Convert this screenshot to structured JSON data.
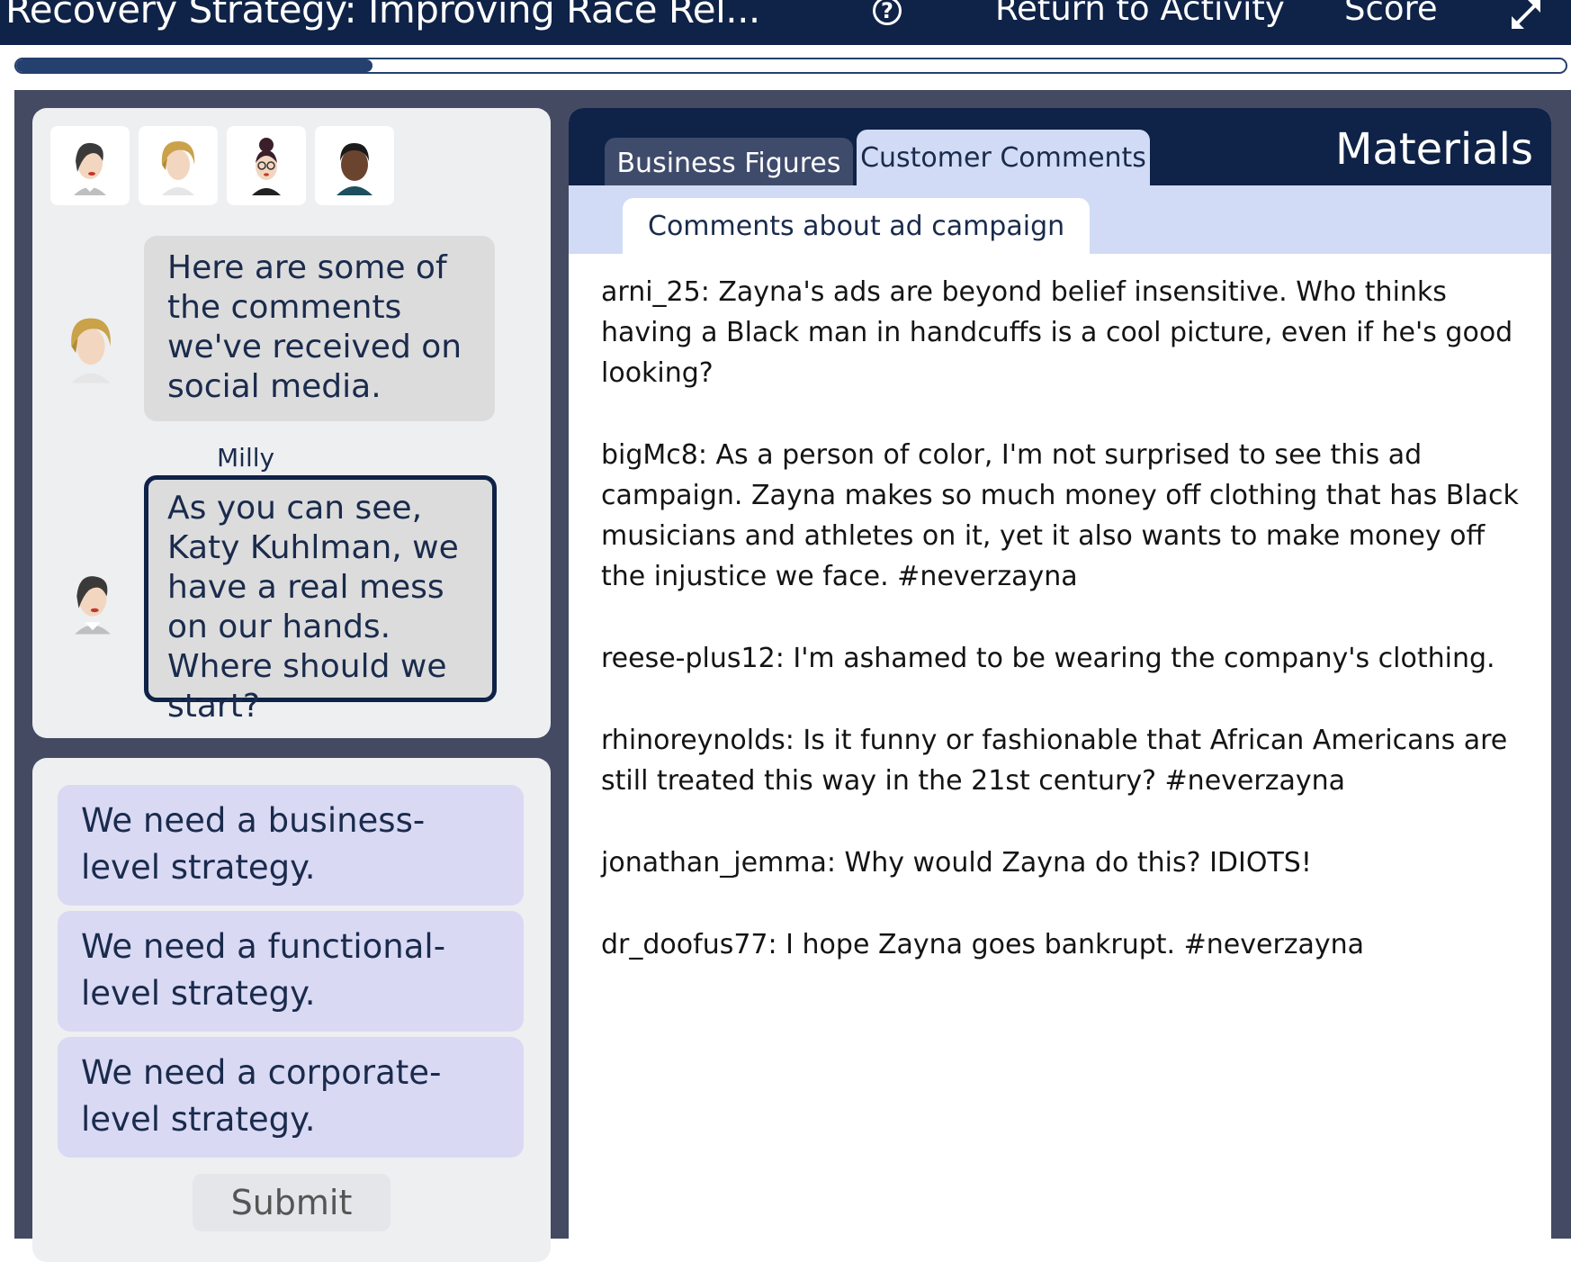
{
  "header": {
    "title": "Recovery Strategy: Improving Race Rel...",
    "help_glyph": "?",
    "return_label": "Return to Activity",
    "score_label": "Score"
  },
  "progress": {
    "fraction": 0.23
  },
  "chat": {
    "avatars": [
      {
        "name": "dark-hair-woman-avatar"
      },
      {
        "name": "blonde-woman-avatar"
      },
      {
        "name": "glasses-woman-avatar"
      },
      {
        "name": "dark-skin-man-avatar"
      }
    ],
    "messages": [
      {
        "text": "Here are some of the comments we've received on social media.",
        "speaker": "Milly"
      },
      {
        "text": "As you can see, Katy Kuhlman, we have a real mess on our hands. Where should we start?"
      }
    ]
  },
  "options": [
    {
      "label": "We need a business-level strategy."
    },
    {
      "label": "We need a functional-level strategy."
    },
    {
      "label": "We need a corporate-level strategy."
    }
  ],
  "submit_label": "Submit",
  "materials": {
    "title": "Materials",
    "tabs": [
      {
        "label": "Business Figures"
      },
      {
        "label": "Customer Comments"
      }
    ],
    "subtab": "Comments about ad campaign",
    "comments": [
      "arni_25: Zayna's ads are beyond belief insensitive. Who thinks having a Black man in handcuffs is a cool picture, even if he's good looking?",
      "bigMc8: As a person of color, I'm not surprised to see this ad campaign. Zayna makes so much money off clothing that has Black musicians and athletes on it, yet it also wants to make money off the injustice we face. #neverzayna",
      "reese-plus12: I'm ashamed to be wearing the company's clothing.",
      "rhinoreynolds: Is it funny or fashionable that African Americans are still treated this way in the 21st century? #neverzayna",
      "jonathan_jemma: Why would Zayna do this? IDIOTS!",
      "dr_doofus77: I hope Zayna goes bankrupt. #neverzayna"
    ]
  },
  "colors": {
    "header_bg": "#0f2247",
    "option_bg": "#d9d9f4",
    "subtab_bg": "#d1dbf5"
  }
}
